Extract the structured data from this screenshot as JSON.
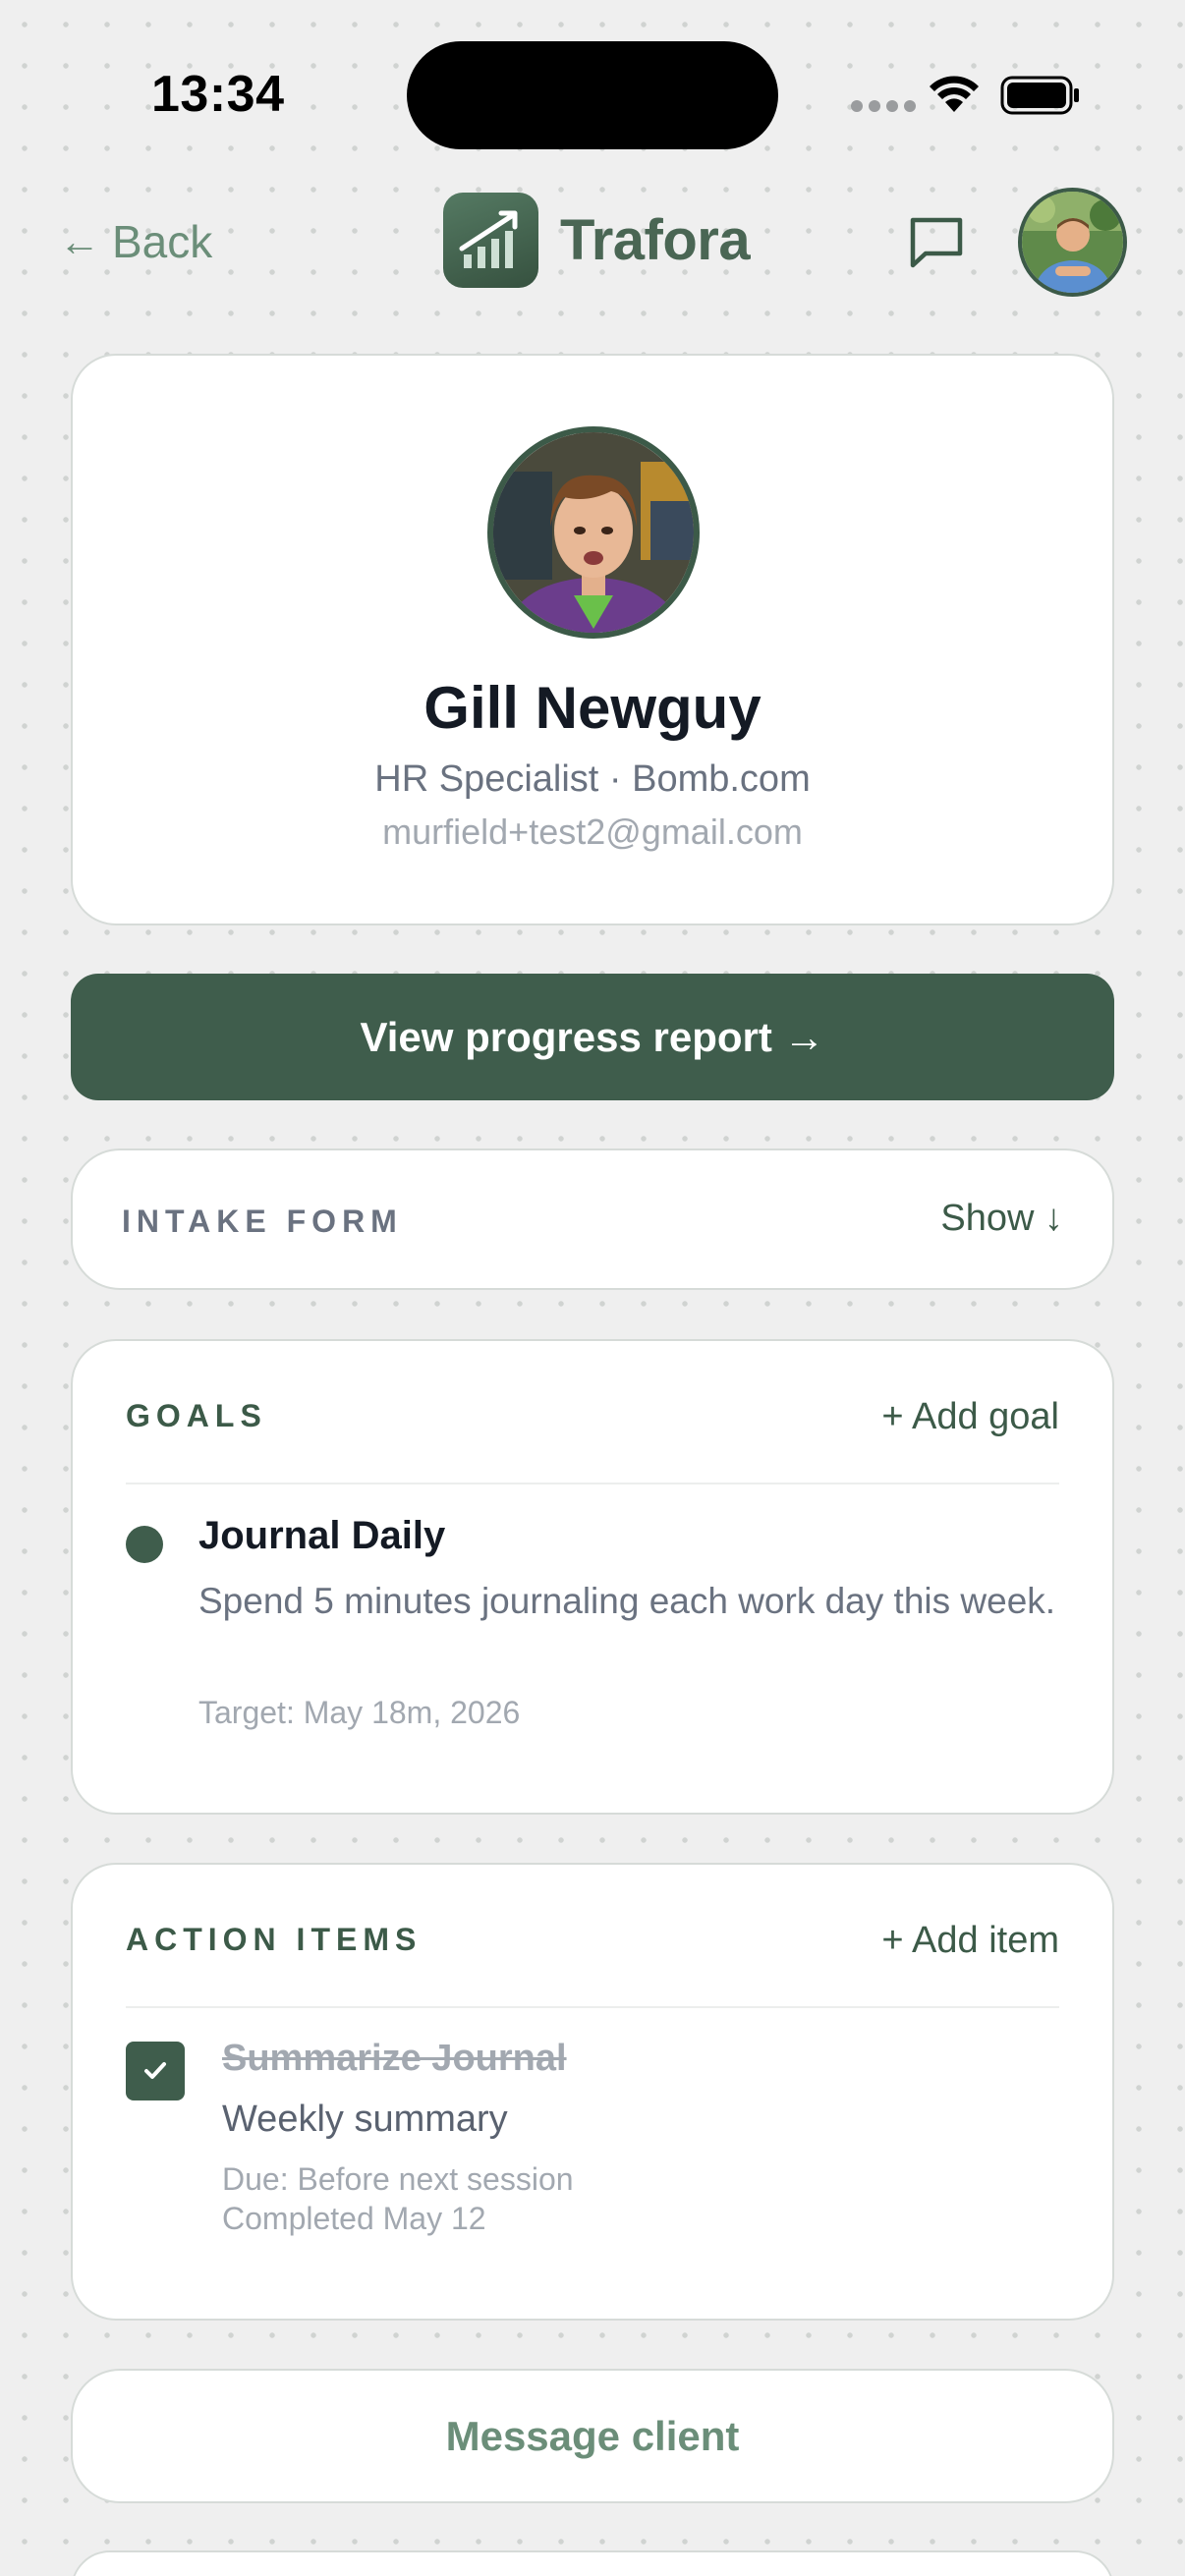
{
  "status_bar": {
    "time": "13:34"
  },
  "header": {
    "back_label": "Back",
    "back_arrow": "←",
    "brand_name": "Trafora",
    "icons": [
      "arrow-left-icon",
      "trafora-logo-icon",
      "chat-bubble-icon",
      "user-avatar"
    ]
  },
  "profile": {
    "name": "Gill Newguy",
    "role_company": "HR Specialist · Bomb.com",
    "email": "murfield+test2@gmail.com"
  },
  "progress_button": {
    "label": "View progress report →"
  },
  "intake_form": {
    "label": "INTAKE FORM",
    "toggle_label": "Show ↓"
  },
  "goals": {
    "label": "GOALS",
    "add_label": "+ Add goal",
    "items": [
      {
        "title": "Journal Daily",
        "description": "Spend 5 minutes journaling each work day this week.",
        "target": "Target: May 18m, 2026"
      }
    ]
  },
  "action_items": {
    "label": "ACTION ITEMS",
    "add_label": "+ Add item",
    "items": [
      {
        "title": "Summarize Journal",
        "description": "Weekly summary",
        "due": "Due: Before next session",
        "completed": "Completed May 12",
        "checked": true
      }
    ]
  },
  "message_button": {
    "label": "Message client"
  },
  "colors": {
    "brand_green": "#3f5d4c",
    "link_green": "#6b8e79",
    "background": "#efefef",
    "card": "#ffffff"
  }
}
